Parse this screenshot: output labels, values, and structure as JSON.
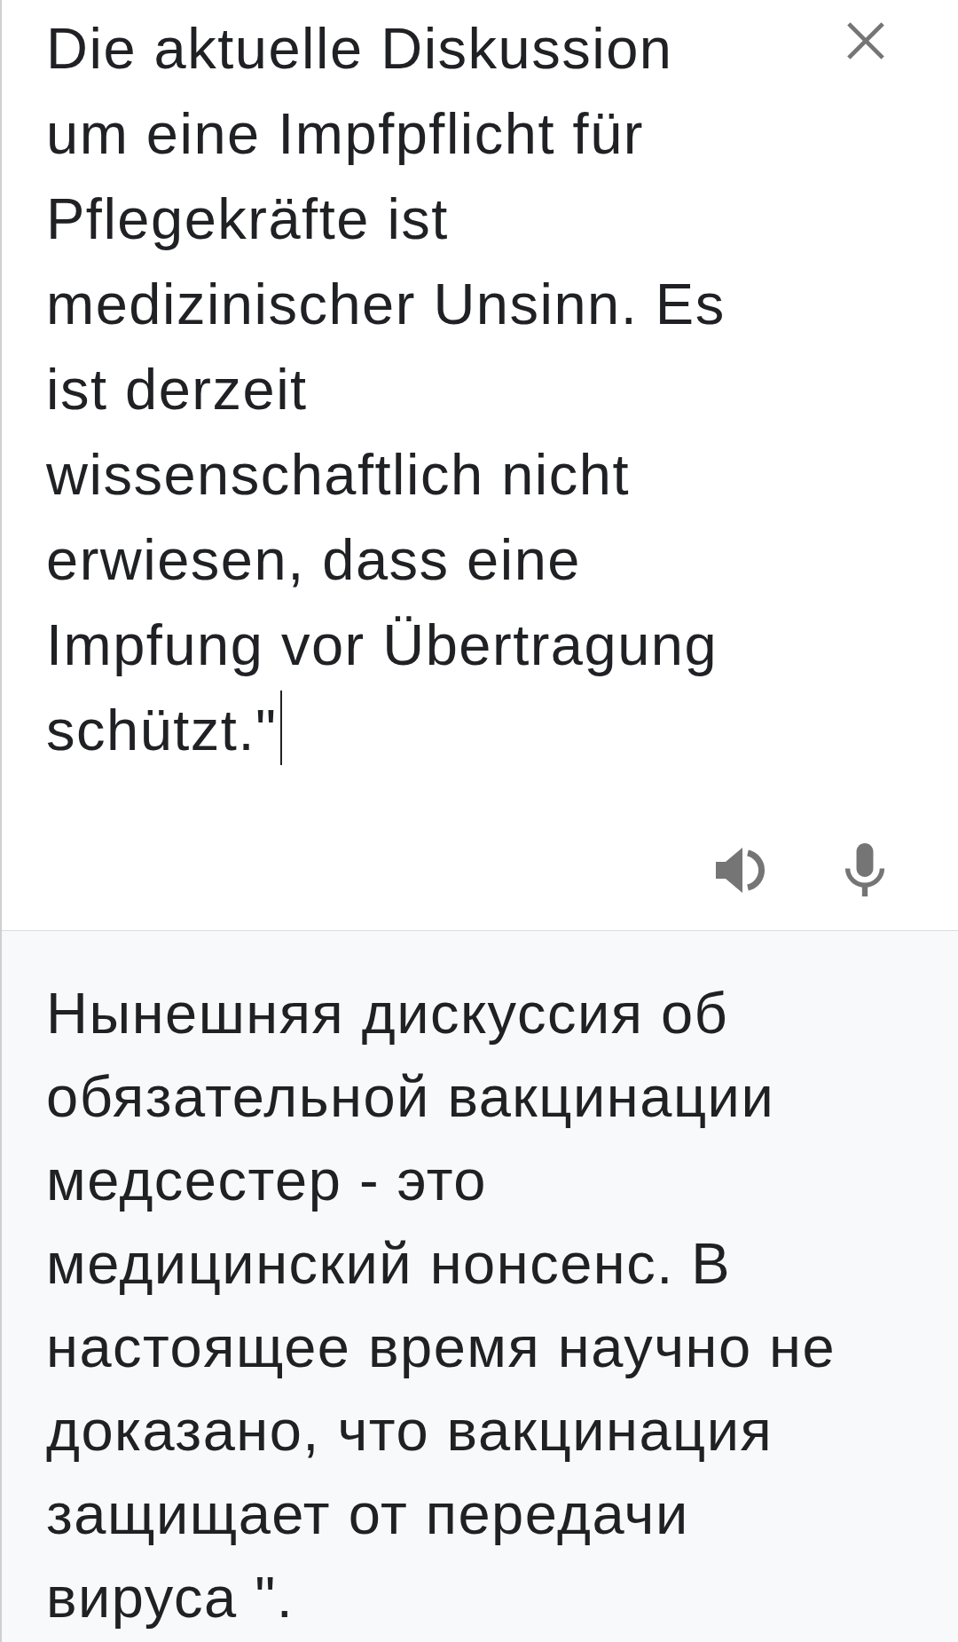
{
  "source": {
    "text": "Die aktuelle Diskussion um eine Impfpflicht für Pflegekräfte ist medizinischer Unsinn. Es ist derzeit wissenschaftlich nicht erwiesen, dass eine Impfung vor Übertragung schützt.\"",
    "focused": true
  },
  "translation": {
    "text": "Нынешняя дискуссия об обязательной вакцинации медсестер - это медицинский нонсенс. В настоящее время научно не доказано, что вакцинация защищает от передачи вируса \"."
  }
}
